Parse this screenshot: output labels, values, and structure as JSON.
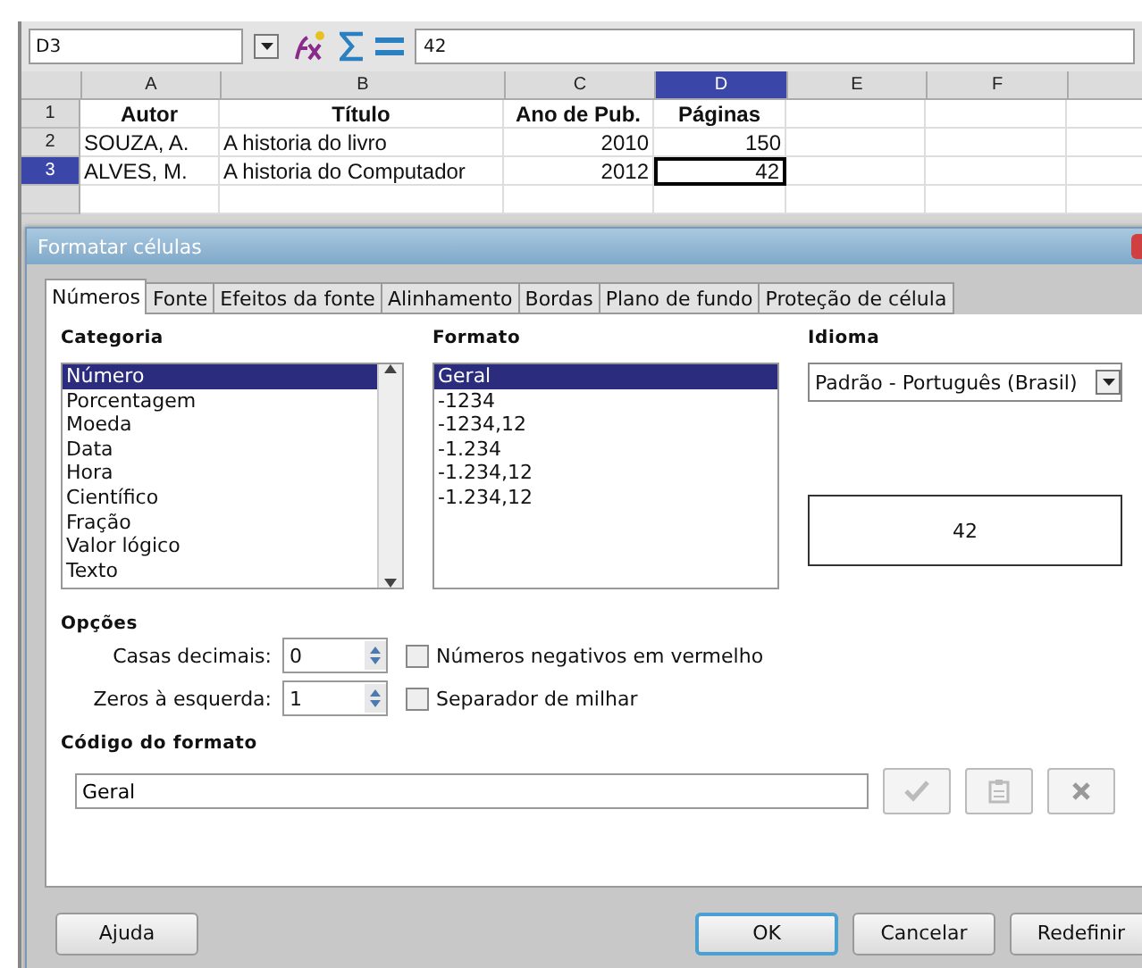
{
  "formula_bar": {
    "cell_ref": "D3",
    "value": "42"
  },
  "sheet": {
    "columns": [
      {
        "label": "A",
        "selected": false
      },
      {
        "label": "B",
        "selected": false
      },
      {
        "label": "C",
        "selected": false
      },
      {
        "label": "D",
        "selected": true
      },
      {
        "label": "E",
        "selected": false
      },
      {
        "label": "F",
        "selected": false
      }
    ],
    "rows": [
      {
        "label": "1",
        "selected": false,
        "cells": [
          {
            "kind": "header",
            "text": "Autor",
            "selected": false
          },
          {
            "kind": "header",
            "text": "Título",
            "selected": false
          },
          {
            "kind": "header",
            "text": "Ano de Pub.",
            "selected": false
          },
          {
            "kind": "header",
            "text": "Páginas",
            "selected": false
          }
        ]
      },
      {
        "label": "2",
        "selected": false,
        "cells": [
          {
            "kind": "text",
            "text": "SOUZA, A.",
            "selected": false
          },
          {
            "kind": "text",
            "text": "A historia do livro",
            "selected": false
          },
          {
            "kind": "number",
            "text": "2010",
            "selected": false
          },
          {
            "kind": "number",
            "text": "150",
            "selected": false
          }
        ]
      },
      {
        "label": "3",
        "selected": true,
        "cells": [
          {
            "kind": "text",
            "text": "ALVES, M.",
            "selected": false
          },
          {
            "kind": "text",
            "text": "A historia do Computador",
            "selected": false
          },
          {
            "kind": "number",
            "text": "2012",
            "selected": false
          },
          {
            "kind": "number",
            "text": "42",
            "selected": true
          }
        ]
      }
    ]
  },
  "dialog": {
    "title": "Formatar células",
    "tabs": [
      {
        "label": "Números",
        "selected": true
      },
      {
        "label": "Fonte",
        "selected": false
      },
      {
        "label": "Efeitos da fonte",
        "selected": false
      },
      {
        "label": "Alinhamento",
        "selected": false
      },
      {
        "label": "Bordas",
        "selected": false
      },
      {
        "label": "Plano de fundo",
        "selected": false
      },
      {
        "label": "Proteção de célula",
        "selected": false
      }
    ],
    "category": {
      "label": "Categoria",
      "items": [
        {
          "label": "Número",
          "selected": true
        },
        {
          "label": "Porcentagem",
          "selected": false
        },
        {
          "label": "Moeda",
          "selected": false
        },
        {
          "label": "Data",
          "selected": false
        },
        {
          "label": "Hora",
          "selected": false
        },
        {
          "label": "Científico",
          "selected": false
        },
        {
          "label": "Fração",
          "selected": false
        },
        {
          "label": "Valor lógico",
          "selected": false
        },
        {
          "label": "Texto",
          "selected": false
        }
      ]
    },
    "format": {
      "label": "Formato",
      "items": [
        {
          "label": "Geral",
          "selected": true
        },
        {
          "label": "-1234",
          "selected": false
        },
        {
          "label": "-1234,12",
          "selected": false
        },
        {
          "label": "-1.234",
          "selected": false
        },
        {
          "label": "-1.234,12",
          "selected": false
        },
        {
          "label": "-1.234,12",
          "selected": false
        }
      ]
    },
    "language": {
      "label": "Idioma",
      "value": "Padrão - Português (Brasil)"
    },
    "preview": "42",
    "options": {
      "label": "Opções",
      "spinners": [
        {
          "label": "Casas decimais:",
          "value": "0"
        },
        {
          "label": "Zeros à esquerda:",
          "value": "1"
        }
      ],
      "checkboxes": [
        {
          "label": "Números negativos em vermelho",
          "checked": false
        },
        {
          "label": "Separador de milhar",
          "checked": false
        }
      ]
    },
    "format_code": {
      "label": "Código do formato",
      "value": "Geral"
    },
    "buttons": [
      {
        "label": "Ajuda",
        "default": false
      },
      {
        "label": "OK",
        "default": true
      },
      {
        "label": "Cancelar",
        "default": false
      },
      {
        "label": "Redefinir",
        "default": false
      }
    ]
  }
}
